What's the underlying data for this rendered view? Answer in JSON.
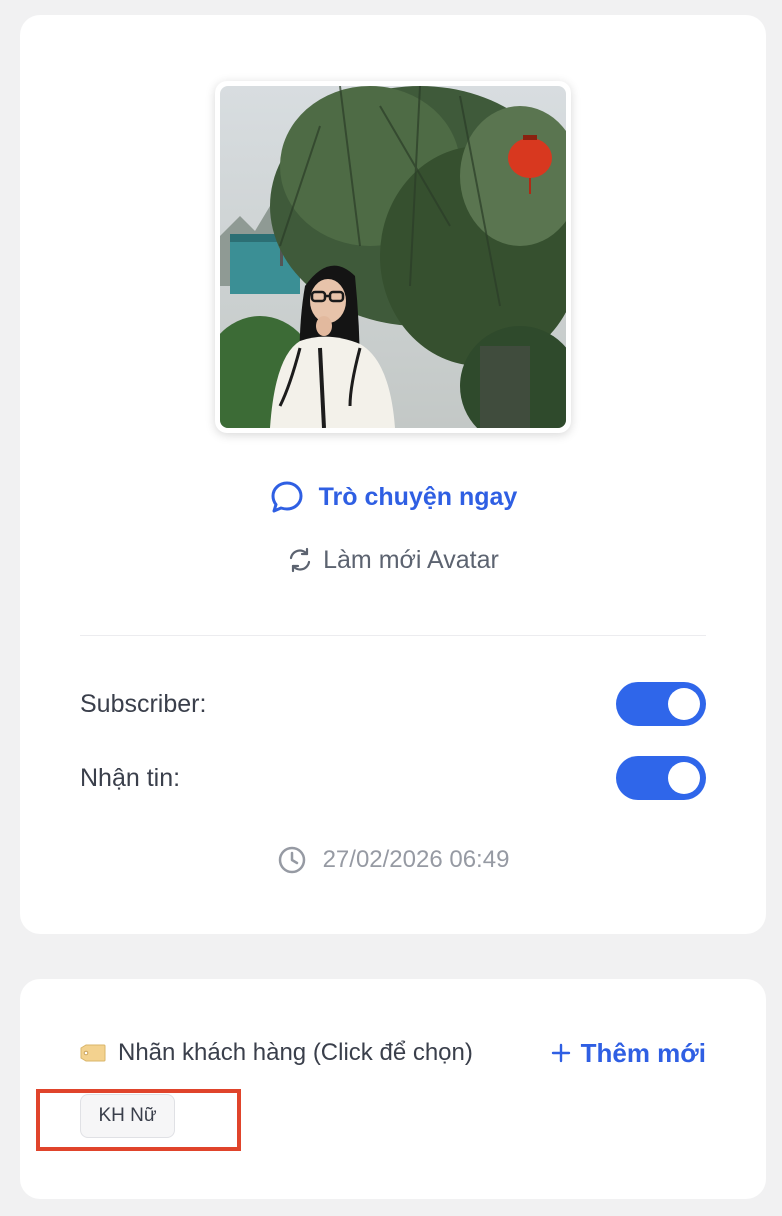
{
  "profile": {
    "chat_label": "Trò chuyện ngay",
    "refresh_label": "Làm mới Avatar",
    "settings": [
      {
        "label": "Subscriber:",
        "enabled": true
      },
      {
        "label": "Nhận tin:",
        "enabled": true
      }
    ],
    "timestamp": "27/02/2026 06:49"
  },
  "labels": {
    "title": "Nhãn khách hàng (Click để chọn)",
    "add_label": "Thêm mới",
    "tags": [
      "KH Nữ"
    ]
  },
  "icons": {
    "chat": "chat-bubble-icon",
    "refresh": "refresh-icon",
    "clock": "clock-icon",
    "tag": "tag-icon",
    "plus": "plus-icon"
  },
  "colors": {
    "accent": "#2f5fe3",
    "toggle_on": "#2f66ea",
    "highlight": "#e0442b"
  }
}
